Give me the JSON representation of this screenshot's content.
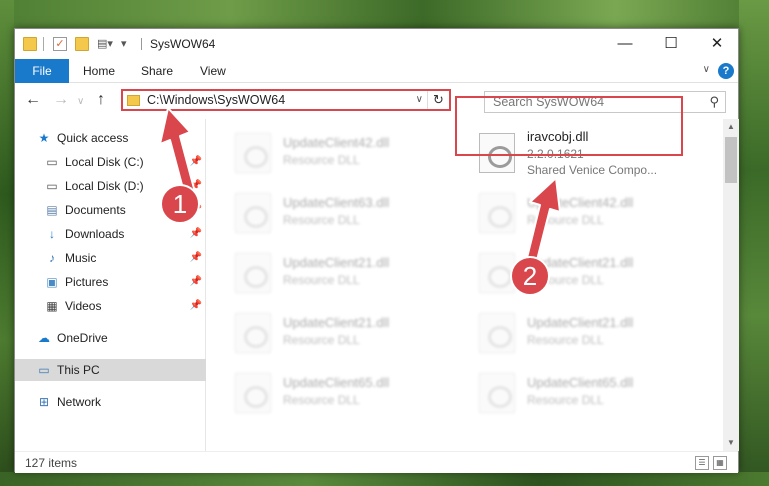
{
  "window": {
    "title": "SysWOW64"
  },
  "titlebar": {
    "minimize": "—",
    "maximize": "☐",
    "close": "✕"
  },
  "ribbon": {
    "file": "File",
    "tabs": [
      "Home",
      "Share",
      "View"
    ],
    "help": "?"
  },
  "address": {
    "path": "C:\\Windows\\SysWOW64",
    "search_placeholder": "Search SysWOW64"
  },
  "sidebar": {
    "items": [
      {
        "label": "Quick access",
        "icon": "star-icon",
        "pinned": false
      },
      {
        "label": "Local Disk (C:)",
        "icon": "drive-icon",
        "pinned": true
      },
      {
        "label": "Local Disk (D:)",
        "icon": "drive-icon",
        "pinned": true
      },
      {
        "label": "Documents",
        "icon": "documents-icon",
        "pinned": true
      },
      {
        "label": "Downloads",
        "icon": "download-icon",
        "pinned": true
      },
      {
        "label": "Music",
        "icon": "music-icon",
        "pinned": true
      },
      {
        "label": "Pictures",
        "icon": "pictures-icon",
        "pinned": true
      },
      {
        "label": "Videos",
        "icon": "videos-icon",
        "pinned": true
      },
      {
        "label": "OneDrive",
        "icon": "cloud-icon",
        "pinned": false
      },
      {
        "label": "This PC",
        "icon": "computer-icon",
        "pinned": false
      },
      {
        "label": "Network",
        "icon": "network-icon",
        "pinned": false
      }
    ]
  },
  "files": {
    "left_column": [
      {
        "name": "UpdateClient42.dll",
        "type": "Resource DLL"
      },
      {
        "name": "UpdateClient63.dll",
        "type": "Resource DLL"
      },
      {
        "name": "UpdateClient21.dll",
        "type": "Resource DLL"
      },
      {
        "name": "UpdateClient21.dll",
        "type": "Resource DLL"
      },
      {
        "name": "UpdateClient65.dll",
        "type": "Resource DLL"
      }
    ],
    "highlighted": {
      "name": "iravcobj.dll",
      "version": "2.2.0.1621",
      "company": "Shared Venice Compo..."
    },
    "right_column": [
      {
        "name": "UpdateClient42.dll",
        "type": "Resource DLL"
      },
      {
        "name": "UpdateClient21.dll",
        "type": "Resource DLL"
      },
      {
        "name": "UpdateClient21.dll",
        "type": "Resource DLL"
      },
      {
        "name": "UpdateClient65.dll",
        "type": "Resource DLL"
      }
    ]
  },
  "status": {
    "item_count": "127 items"
  },
  "annotations": {
    "step1": "1",
    "step2": "2",
    "color": "#d9464b"
  },
  "colors": {
    "accent": "#1979ca",
    "highlight": "#d9464b"
  }
}
